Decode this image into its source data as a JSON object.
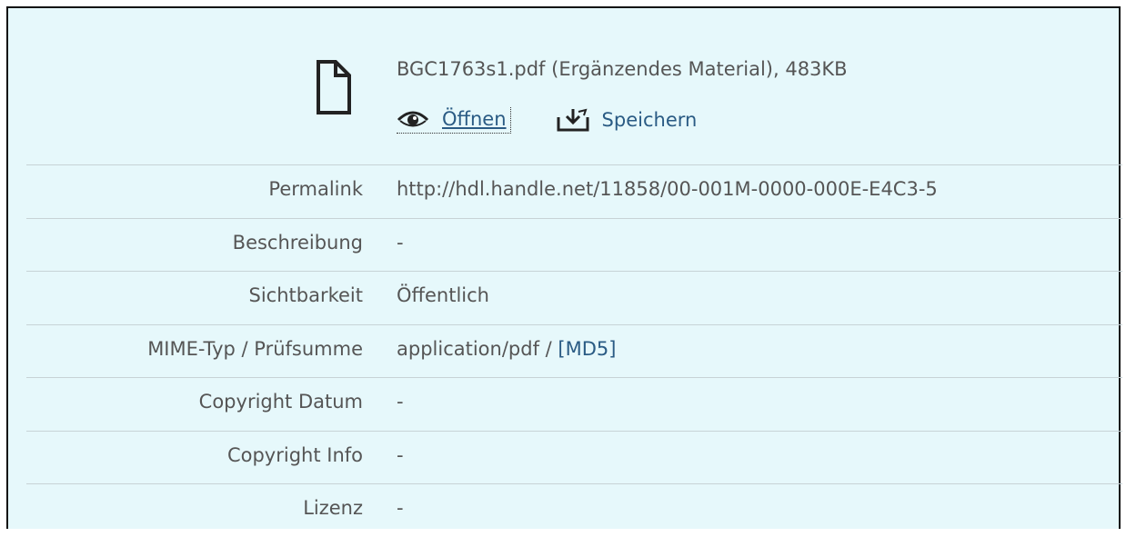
{
  "file": {
    "title": "BGC1763s1.pdf (Ergänzendes Material), 483KB",
    "open_label": "Öffnen",
    "save_label": "Speichern"
  },
  "details": {
    "permalink": {
      "label": "Permalink",
      "value": "http://hdl.handle.net/11858/00-001M-0000-000E-E4C3-5"
    },
    "description": {
      "label": "Beschreibung",
      "value": "-"
    },
    "visibility": {
      "label": "Sichtbarkeit",
      "value": "Öffentlich"
    },
    "mime": {
      "label": "MIME-Typ / Prüfsumme",
      "value_prefix": "application/pdf / ",
      "checksum_link": "[MD5]"
    },
    "copyright_date": {
      "label": "Copyright Datum",
      "value": "-"
    },
    "copyright_info": {
      "label": "Copyright Info",
      "value": "-"
    },
    "license": {
      "label": "Lizenz",
      "value": "-"
    }
  },
  "colors": {
    "background": "#e6f8fb",
    "link": "#2a5b84",
    "text": "#555555",
    "divider": "#c7d3d6"
  },
  "icons": [
    "file-icon",
    "eye-icon",
    "download-icon"
  ]
}
